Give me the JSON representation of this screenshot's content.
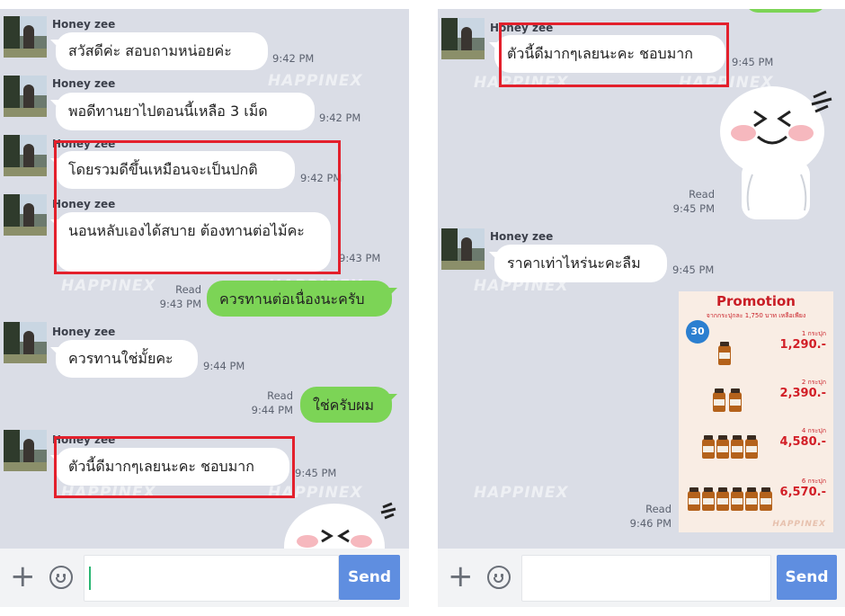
{
  "left": {
    "messages": [
      {
        "name": "Honey zee",
        "text": "สวัสดีค่ะ สอบถามหน่อยค่ะ",
        "time": "9:42 PM"
      },
      {
        "name": "Honey zee",
        "text": "พอดีทานยาไปตอนนี้เหลือ  3 เม็ด",
        "time": "9:42 PM"
      },
      {
        "name": "Honey zee",
        "text": "โดยรวมดีขึ้นเหมือนจะเป็นปกติ",
        "time": "9:42 PM"
      },
      {
        "name": "Honey zee",
        "text": "นอนหลับเองได้สบาย ต้องทานต่อไม้คะ",
        "time": "9:43 PM"
      },
      {
        "name": "Honey zee",
        "text": "ควรทานใช่มั้ยคะ",
        "time": "9:44 PM"
      },
      {
        "name": "Honey zee",
        "text": "ตัวนี้ดีมากๆเลยนะคะ ชอบมาก",
        "time": "9:45 PM"
      }
    ],
    "outgoing": [
      {
        "read": "Read",
        "time": "9:43 PM",
        "text": "ควรทานต่อเนื่องนะครับ"
      },
      {
        "read": "Read",
        "time": "9:44 PM",
        "text": "ใช่ครับผม"
      }
    ]
  },
  "right": {
    "messages": [
      {
        "name": "Honey zee",
        "text": "ตัวนี้ดีมากๆเลยนะคะ ชอบมาก",
        "time": "9:45 PM"
      },
      {
        "name": "Honey zee",
        "text": "ราคาเท่าไหร่นะคะลืม",
        "time": "9:45 PM"
      }
    ],
    "sticker_read": {
      "read": "Read",
      "time": "9:45 PM"
    },
    "image_read": {
      "read": "Read",
      "time": "9:46 PM"
    },
    "promo": {
      "title": "Promotion",
      "subtitle": "จากกระปุกละ 1,750 บาท เหลือเพียง",
      "badge": "30",
      "tiers": [
        {
          "label": "1 กระปุก",
          "price": "1,290.-"
        },
        {
          "label": "2 กระปุก",
          "price": "2,390.-"
        },
        {
          "label": "4 กระปุก",
          "price": "4,580.-"
        },
        {
          "label": "6 กระปุก",
          "price": "6,570.-"
        }
      ],
      "brand": "HAPPINEX"
    }
  },
  "watermark": "HAPPINEX",
  "input": {
    "send_label": "Send",
    "value": ""
  },
  "colors": {
    "chat_bg": "#dadde6",
    "outgoing_bubble": "#7cd456",
    "send_button": "#5f8ee0",
    "highlight": "#e3202c"
  }
}
